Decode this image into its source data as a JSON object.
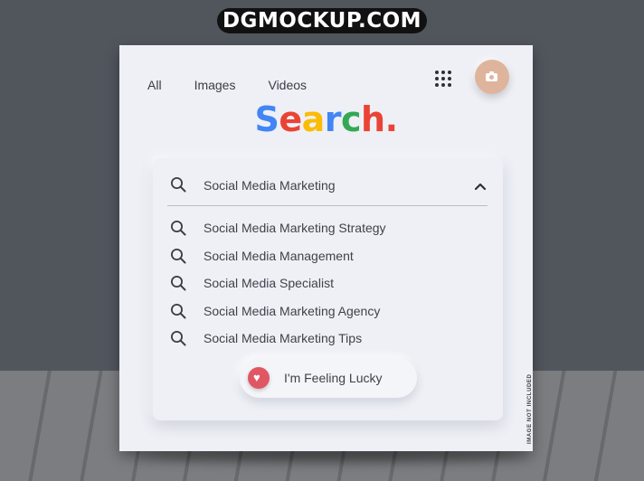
{
  "watermark": "DGMOCKUP.COM",
  "tabs": [
    {
      "label": "All"
    },
    {
      "label": "Images"
    },
    {
      "label": "Videos"
    }
  ],
  "icons": {
    "apps": "grid-icon",
    "camera": "camera-icon",
    "search": "search-icon",
    "collapse": "chevron-up-icon",
    "lucky": "heart-icon"
  },
  "logo": {
    "letters": [
      {
        "char": "S",
        "color": "#4285f4"
      },
      {
        "char": "e",
        "color": "#ea4335"
      },
      {
        "char": "a",
        "color": "#fbbc05"
      },
      {
        "char": "r",
        "color": "#4285f4"
      },
      {
        "char": "c",
        "color": "#34a853"
      },
      {
        "char": "h",
        "color": "#ea4335"
      },
      {
        "char": ".",
        "color": "#ea4335"
      }
    ]
  },
  "search": {
    "query": "Social Media Marketing"
  },
  "suggestions": [
    {
      "label": "Social Media Marketing Strategy"
    },
    {
      "label": "Social Media Management"
    },
    {
      "label": "Social Media Specialist"
    },
    {
      "label": "Social Media Marketing Agency"
    },
    {
      "label": "Social Media Marketing Tips"
    }
  ],
  "lucky_button": {
    "label": "I'm Feeling Lucky"
  },
  "side_note": "IMAGE NOT INCLUDED",
  "colors": {
    "background": "#51565d",
    "panel": "#eef0f6",
    "camera_button": "#dfb49c",
    "heart": "#e05763"
  }
}
